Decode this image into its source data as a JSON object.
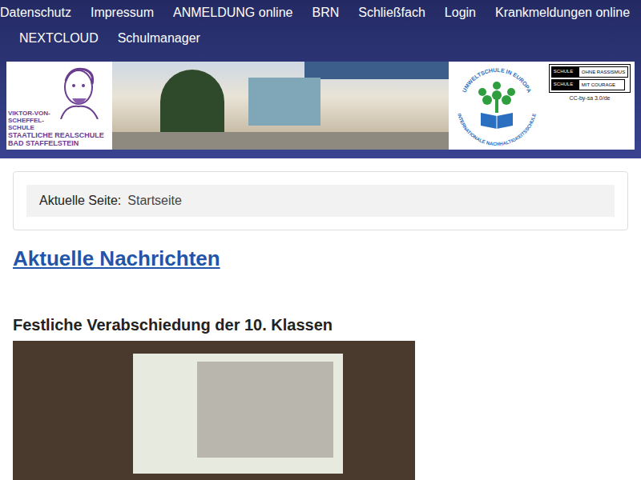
{
  "nav": {
    "items": [
      "Datenschutz",
      "Impressum",
      "ANMELDUNG online",
      "BRN",
      "Schließfach",
      "Login",
      "Krankmeldungen online",
      "NEXTCLOUD",
      "Schulmanager"
    ]
  },
  "banner": {
    "school_logo": {
      "lines": [
        "VIKTOR-VON-",
        "SCHEFFEL-",
        "SCHULE",
        "STAATLICHE REALSCHULE",
        "BAD STAFFELSTEIN"
      ]
    },
    "eco_logo": {
      "top": "UMWELTSCHULE IN EUROPA",
      "bottom": "INTERNATIONALE NACHHALTIGKEITSSCHULE"
    },
    "courage_badge": {
      "rows": [
        {
          "dark": "SCHULE",
          "light": "OHNE RASSISMUS"
        },
        {
          "dark": "SCHULE",
          "light": "MIT COURAGE"
        }
      ],
      "license": "CC-by-sa 3.0/de"
    }
  },
  "breadcrumb": {
    "label": "Aktuelle Seite:",
    "current": "Startseite"
  },
  "news": {
    "heading": "Aktuelle Nachrichten",
    "articles": [
      {
        "title": "Festliche Verabschiedung der 10. Klassen"
      }
    ]
  }
}
